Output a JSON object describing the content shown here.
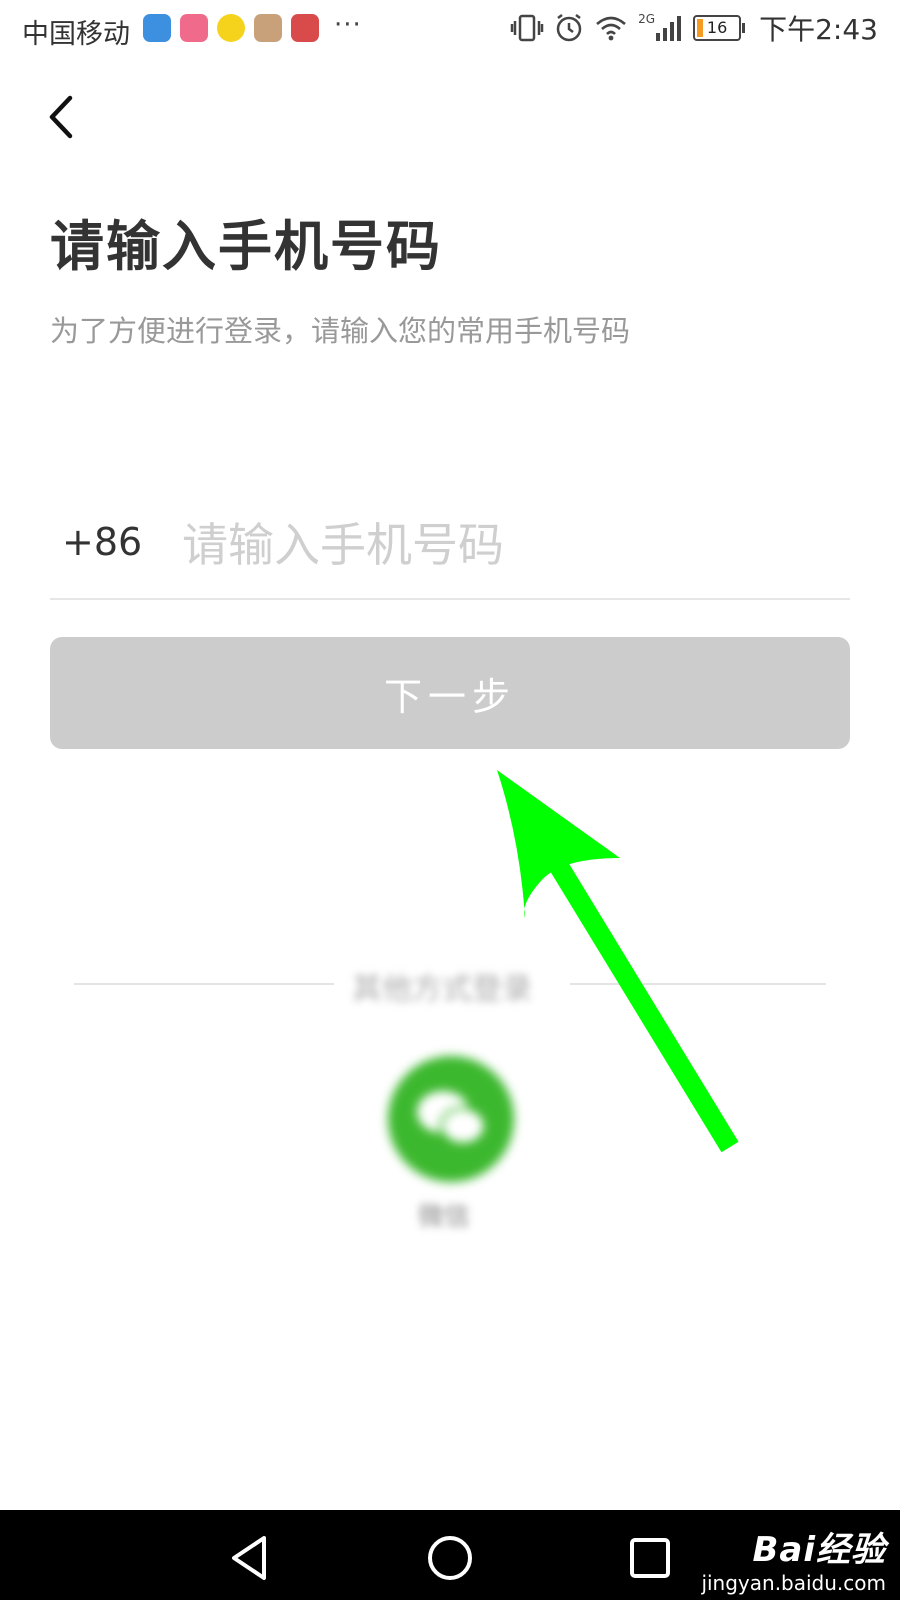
{
  "status_bar": {
    "carrier": "中国移动",
    "more": "···",
    "battery_level": "16",
    "time": "下午2:43",
    "network": "2G"
  },
  "header": {
    "title": "请输入手机号码",
    "subtitle": "为了方便进行登录，请输入您的常用手机号码"
  },
  "phone": {
    "prefix": "+86",
    "placeholder": "请输入手机号码",
    "value": ""
  },
  "next_button": {
    "label": "下一步"
  },
  "other_login": {
    "label": "其他方式登录",
    "wechat_label": "微信"
  },
  "watermark": {
    "logo": "Bai经验",
    "url": "jingyan.baidu.com"
  },
  "colors": {
    "button_disabled": "#cccccc",
    "wechat_green": "#3cb82e",
    "arrow_green": "#00ff00",
    "title": "#333333",
    "subtitle": "#999999"
  },
  "icons": [
    "back-icon",
    "vibrate-icon",
    "alarm-icon",
    "wifi-icon",
    "signal-icon",
    "battery-icon",
    "nav-back-icon",
    "nav-home-icon",
    "nav-recent-icon",
    "wechat-icon"
  ]
}
